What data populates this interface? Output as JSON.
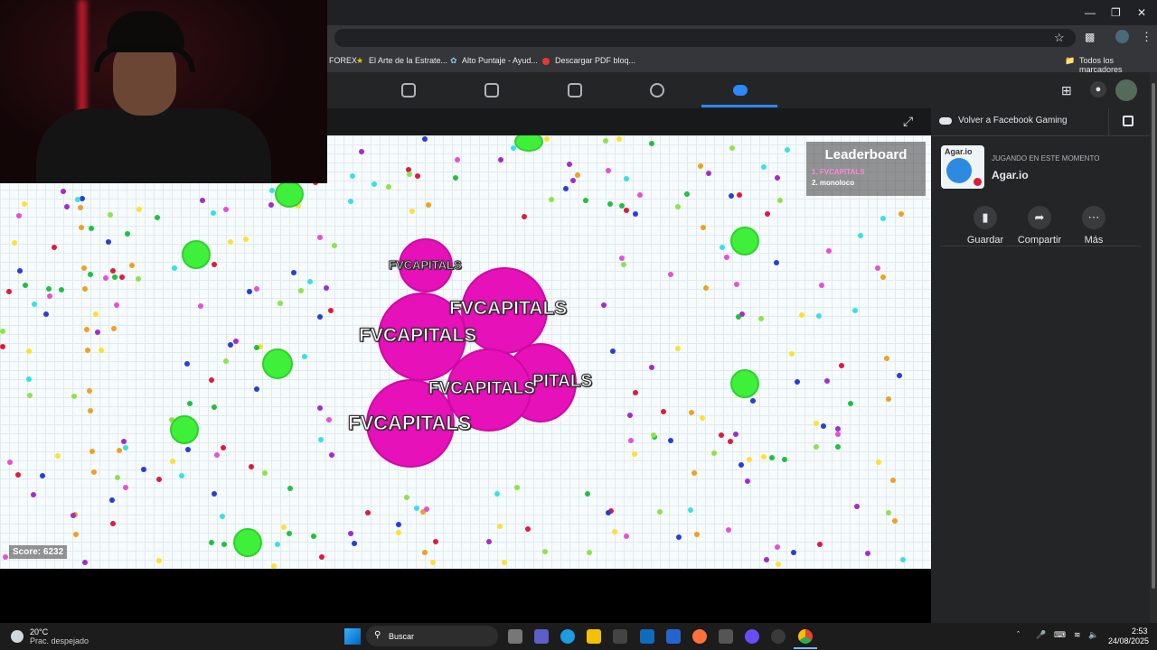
{
  "browser": {
    "bookmarks": [
      "FOREX",
      "El Arte de la Estrate...",
      "Alto Puntaje - Ayud...",
      "Descargar PDF bloq..."
    ],
    "all_bookmarks": "Todos los marcadores"
  },
  "facebook": {
    "nav_icons": [
      "home-icon",
      "watch-icon",
      "marketplace-icon",
      "groups-icon",
      "gaming-icon"
    ],
    "back_to_gaming": "Volver a Facebook Gaming"
  },
  "game": {
    "player_name": "FVCAPITALS",
    "cell_labels": [
      "FVCAPITALS",
      "FVCAPITALS",
      "FVCAPITALS",
      "FVCAPITALS",
      "PITALS",
      "FVCAPITALS"
    ],
    "leaderboard": {
      "title": "Leaderboard",
      "entries": [
        "1. FVCAPITALS",
        "2. monoloco"
      ]
    },
    "score": "Score: 6232",
    "colors": {
      "player": "#e611b8",
      "virus": "#3ef03a",
      "leader_highlight": "#ff8ad8"
    }
  },
  "sidebar": {
    "app_logo_text": "Agar.io",
    "status": "JUGANDO EN ESTE MOMENTO",
    "app_name": "Agar.io",
    "actions": [
      {
        "label": "Guardar",
        "icon": "bookmark-icon"
      },
      {
        "label": "Compartir",
        "icon": "share-icon"
      },
      {
        "label": "Más",
        "icon": "more-icon"
      }
    ]
  },
  "taskbar": {
    "weather_temp": "20°C",
    "weather_desc": "Prac. despejado",
    "search": "Buscar",
    "time": "2:53",
    "date": "24/08/2025"
  }
}
